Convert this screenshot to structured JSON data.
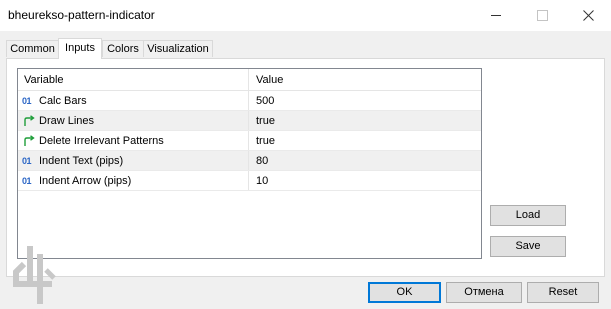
{
  "window": {
    "title": "bheurekso-pattern-indicator",
    "controls": [
      "minimize-icon",
      "maximize-icon",
      "close-icon"
    ]
  },
  "tabs": [
    {
      "label": "Common",
      "active": false
    },
    {
      "label": "Inputs",
      "active": true
    },
    {
      "label": "Colors",
      "active": false
    },
    {
      "label": "Visualization",
      "active": false
    }
  ],
  "grid": {
    "headers": {
      "variable": "Variable",
      "value": "Value"
    },
    "rows": [
      {
        "icon": "integer-icon",
        "icon_text": "01",
        "variable": "Calc Bars",
        "value": "500"
      },
      {
        "icon": "boolean-arrow-icon",
        "variable": "Draw Lines",
        "value": "true"
      },
      {
        "icon": "boolean-arrow-icon",
        "variable": "Delete Irrelevant Patterns",
        "value": "true"
      },
      {
        "icon": "integer-icon",
        "icon_text": "01",
        "variable": "Indent Text (pips)",
        "value": "80"
      },
      {
        "icon": "integer-icon",
        "icon_text": "01",
        "variable": "Indent Arrow (pips)",
        "value": "10"
      }
    ]
  },
  "side_buttons": {
    "load": "Load",
    "save": "Save"
  },
  "footer_buttons": {
    "ok": "OK",
    "cancel": "Отмена",
    "reset": "Reset"
  },
  "colors": {
    "accent": "#0078d7",
    "int_icon": "#2b66c6",
    "bool_icon": "#1f9e3a"
  }
}
